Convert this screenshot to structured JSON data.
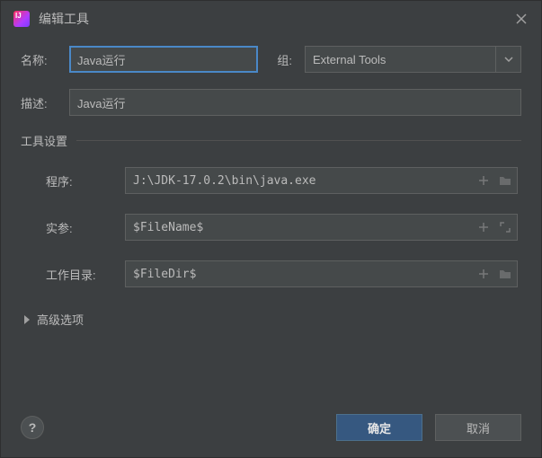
{
  "title": "编辑工具",
  "labels": {
    "name": "名称:",
    "group": "组:",
    "description": "描述:",
    "toolSettings": "工具设置",
    "program": "程序:",
    "arguments": "实参:",
    "workingDir": "工作目录:",
    "advanced": "高级选项"
  },
  "fields": {
    "name": "Java运行",
    "group": "External Tools",
    "description": "Java运行",
    "program": "J:\\JDK-17.0.2\\bin\\java.exe",
    "arguments": "$FileName$",
    "workingDir": "$FileDir$"
  },
  "buttons": {
    "ok": "确定",
    "cancel": "取消",
    "help": "?"
  }
}
